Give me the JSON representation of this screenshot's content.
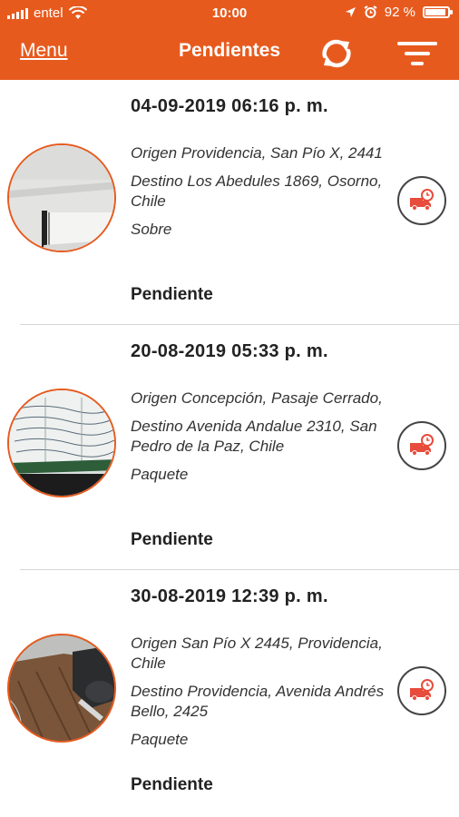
{
  "status_bar": {
    "carrier": "entel",
    "time": "10:00",
    "battery": "92 %",
    "battery_level": 0.92
  },
  "nav": {
    "menu_label": "Menu",
    "title": "Pendientes",
    "refresh_icon": "refresh-icon",
    "filter_icon": "filter-icon"
  },
  "items": [
    {
      "date": "04-09-2019 06:16 p. m.",
      "origin": "Origen Providencia, San Pío X, 2441",
      "destination": "Destino Los Abedules 1869, Osorno, Chile",
      "type": "Sobre",
      "status": "Pendiente"
    },
    {
      "date": "20-08-2019 05:33 p. m.",
      "origin": "Origen Concepción, Pasaje Cerrado,",
      "destination": "Destino Avenida Andalue 2310, San Pedro de la Paz, Chile",
      "type": "Paquete",
      "status": "Pendiente"
    },
    {
      "date": "30-08-2019 12:39 p. m.",
      "origin": "Origen San Pío X 2445, Providencia, Chile",
      "destination": "Destino Providencia, Avenida Andrés Bello, 2425",
      "type": "Paquete",
      "status": "Pendiente"
    }
  ],
  "colors": {
    "accent": "#e75a1e"
  }
}
